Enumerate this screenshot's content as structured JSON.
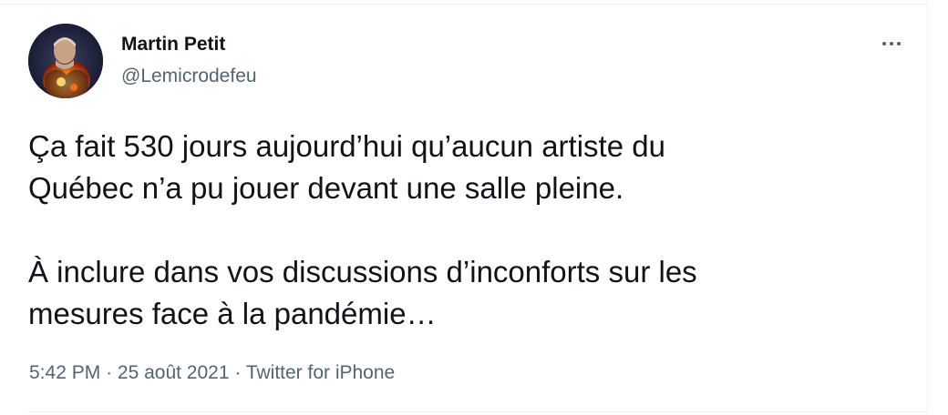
{
  "tweet": {
    "author": {
      "name": "Martin Petit",
      "handle": "@Lemicrodefeu",
      "avatar_icon": "profile-photo-fire"
    },
    "more_icon": "more-horizontal-icon",
    "text": {
      "line1": "Ça fait 530 jours aujourd’hui qu’aucun artiste du",
      "line2": "Québec n’a pu jouer devant une salle pleine.",
      "line3": "À inclure dans vos discussions d’inconforts sur les",
      "line4": "mesures face à la pandémie…"
    },
    "meta": {
      "time": "5:42 PM",
      "separator": "·",
      "date": "25 août 2021",
      "source": "Twitter for iPhone"
    }
  },
  "colors": {
    "text_primary": "#0f1419",
    "text_secondary": "#536471",
    "border": "#eff3f4",
    "background": "#ffffff"
  }
}
